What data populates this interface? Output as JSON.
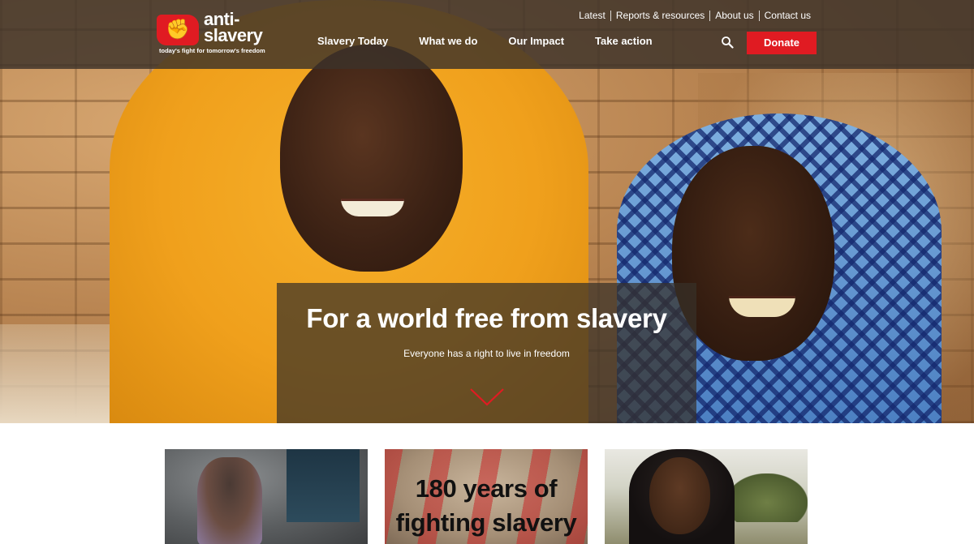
{
  "brand": {
    "logo_mark": "✊",
    "name": "anti-\nslavery",
    "tagline": "today's fight for tomorrow's freedom",
    "accent_color": "#e01b22"
  },
  "utility_nav": [
    "Latest",
    "Reports & resources",
    "About us",
    "Contact us"
  ],
  "main_nav": [
    "Slavery Today",
    "What we do",
    "Our Impact",
    "Take action"
  ],
  "header": {
    "search_icon": "search-icon",
    "donate_label": "Donate"
  },
  "hero": {
    "title": "For a world free from slavery",
    "subtitle": "Everyone has a right to live in freedom",
    "scroll_icon": "chevron-down-icon"
  },
  "cards": [
    {
      "title": ""
    },
    {
      "title": "180 years of\nfighting slavery"
    },
    {
      "title": ""
    }
  ]
}
